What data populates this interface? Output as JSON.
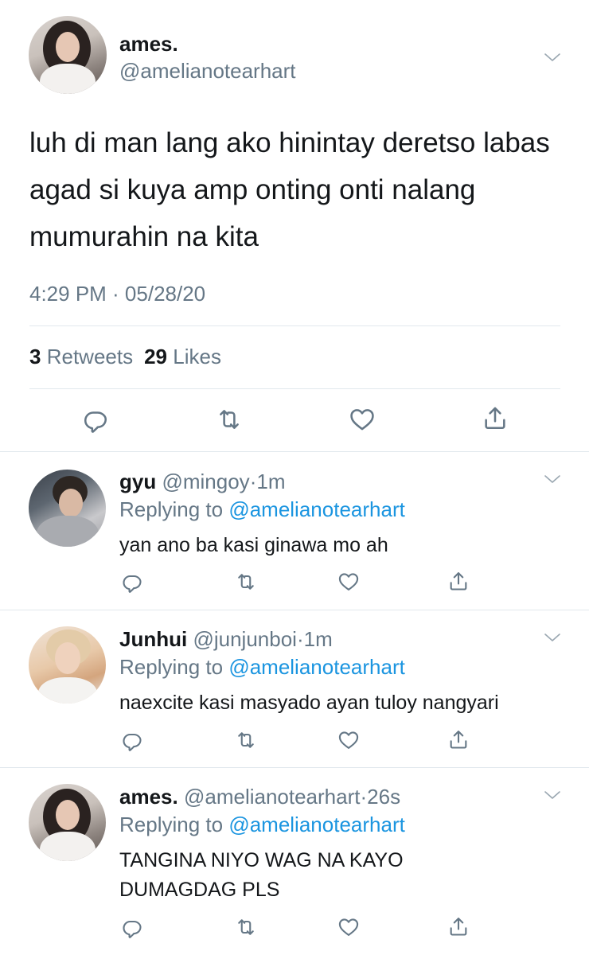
{
  "main_tweet": {
    "name": "ames.",
    "handle": "@amelianotearhart",
    "text": "luh di man lang ako hinintay deretso labas agad si kuya amp onting onti nalang mumurahin na kita",
    "timestamp": "4:29 PM · 05/28/20",
    "retweets_count": "3",
    "retweets_label": "Retweets",
    "likes_count": "29",
    "likes_label": "Likes"
  },
  "replies": [
    {
      "name": "gyu",
      "handle": "@mingoy",
      "separator": "·",
      "time": "1m",
      "replying_prefix": "Replying to",
      "replying_to": "@amelianotearhart",
      "text": "yan ano ba kasi ginawa mo ah"
    },
    {
      "name": "Junhui",
      "handle": "@junjunboi",
      "separator": "·",
      "time": "1m",
      "replying_prefix": "Replying to",
      "replying_to": "@amelianotearhart",
      "text": "naexcite kasi masyado ayan tuloy nangyari"
    },
    {
      "name": "ames.",
      "handle": "@amelianotearhart",
      "separator": "·",
      "time": "26s",
      "replying_prefix": "Replying to",
      "replying_to": "@amelianotearhart",
      "text": "TANGINA NIYO WAG NA KAYO DUMAGDAG PLS"
    }
  ],
  "icons": {
    "reply": "reply-icon",
    "retweet": "retweet-icon",
    "like": "heart-icon",
    "share": "share-icon",
    "menu": "chevron-down-icon"
  },
  "colors": {
    "text": "#14171a",
    "secondary": "#657786",
    "link": "#1b95e0",
    "divider": "#e1e8ed"
  }
}
